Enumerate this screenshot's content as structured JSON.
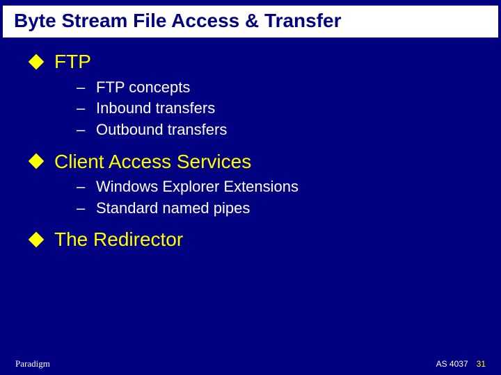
{
  "title": "Byte Stream File Access & Transfer",
  "bullets": [
    {
      "label": "FTP",
      "subs": [
        "FTP concepts",
        "Inbound transfers",
        "Outbound transfers"
      ]
    },
    {
      "label": "Client Access Services",
      "subs": [
        "Windows Explorer Extensions",
        "Standard named pipes"
      ]
    },
    {
      "label": "The Redirector",
      "subs": []
    }
  ],
  "footer": {
    "org": "Paradigm",
    "code": "AS 4037",
    "page": "31"
  }
}
